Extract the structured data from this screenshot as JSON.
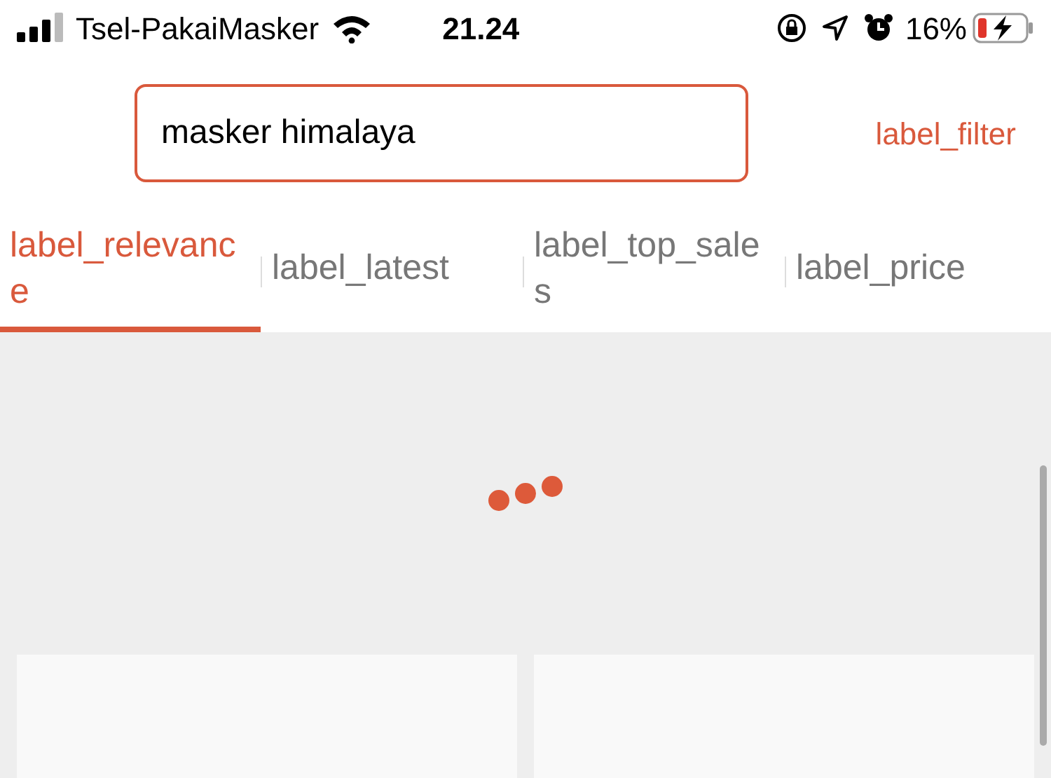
{
  "status_bar": {
    "carrier": "Tsel-PakaiMasker",
    "time": "21.24",
    "battery_percent": "16%",
    "charging": true
  },
  "search": {
    "value": "masker himalaya"
  },
  "filter_link": "label_filter",
  "tabs": [
    {
      "label": "label_relevance",
      "selected": true
    },
    {
      "label": "label_latest",
      "selected": false
    },
    {
      "label": "label_top_sales",
      "selected": false
    },
    {
      "label": "label_price",
      "selected": false
    }
  ],
  "loading": true
}
